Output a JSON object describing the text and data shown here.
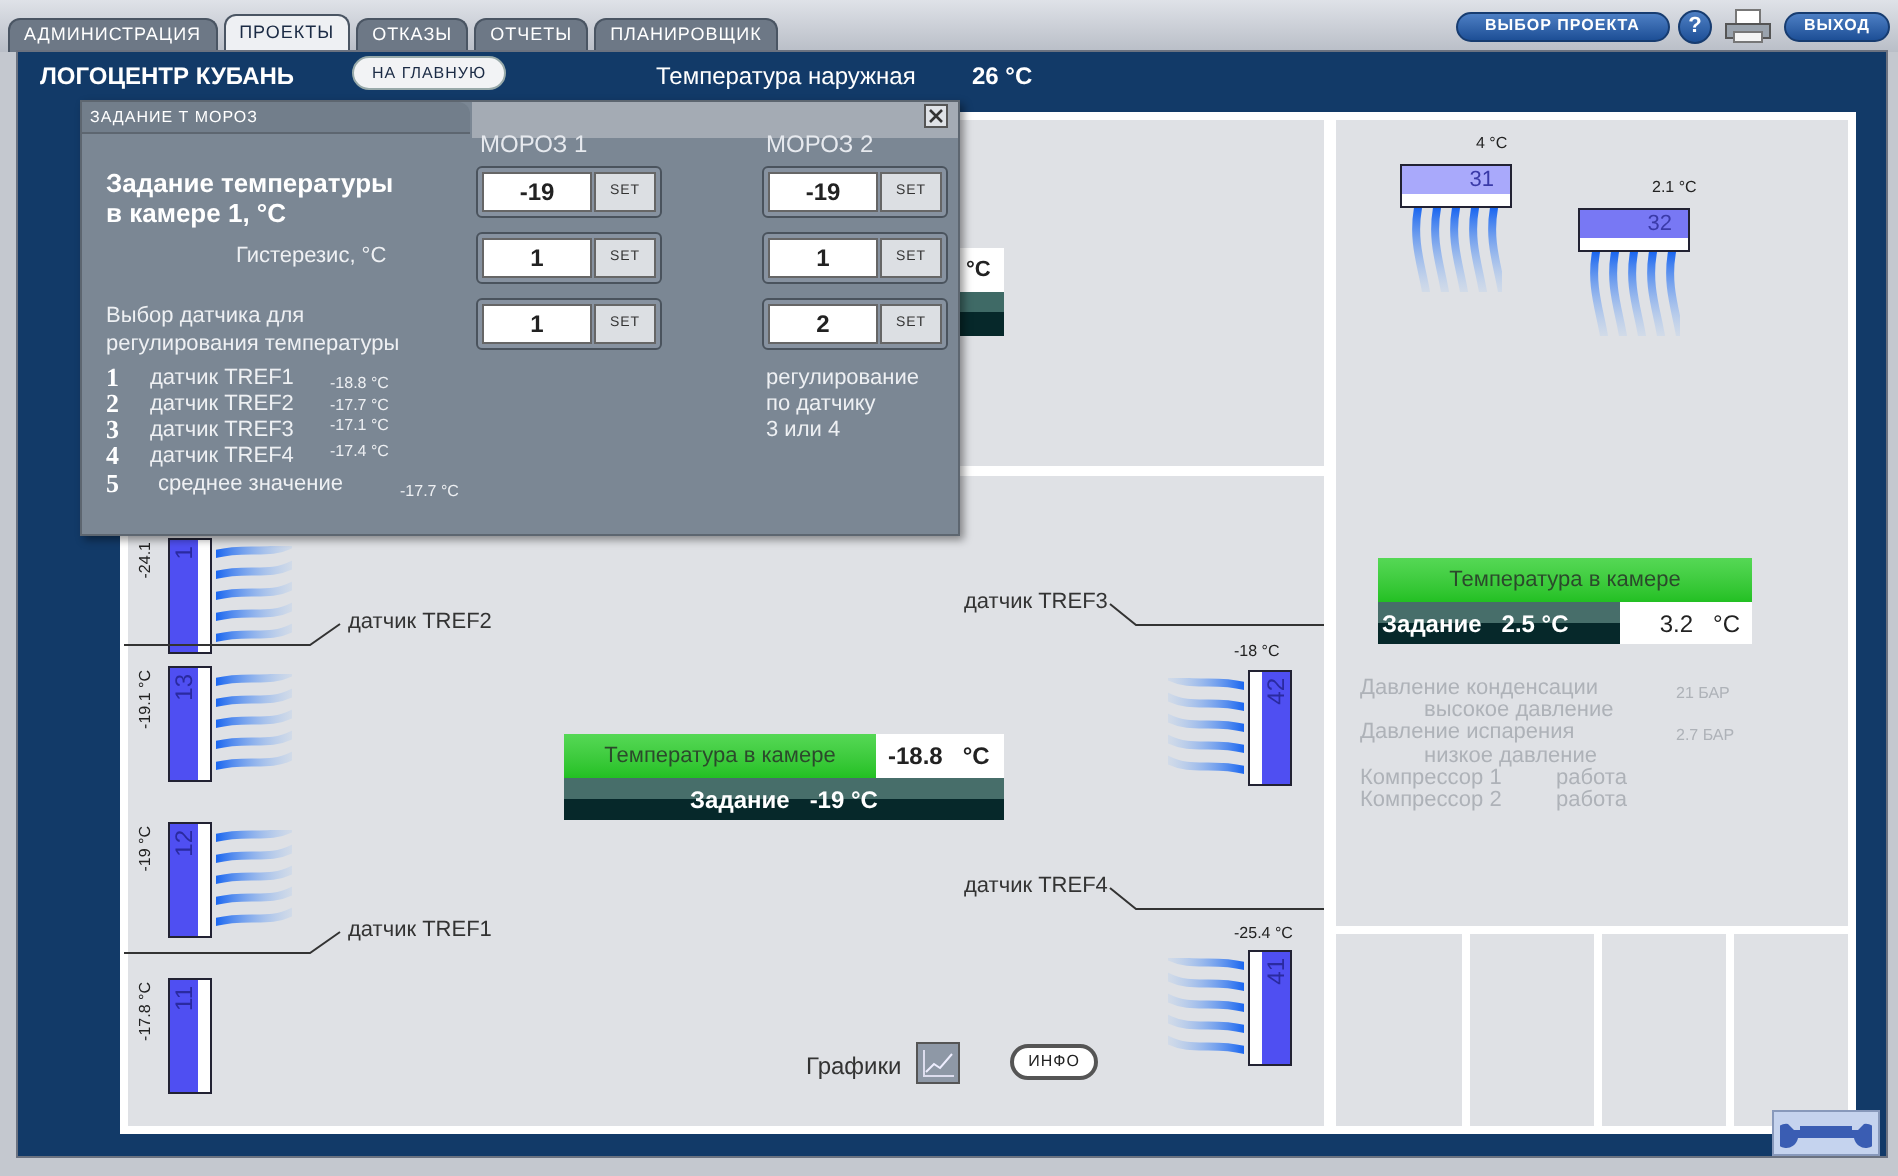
{
  "tabs": [
    {
      "label": "АДМИНИСТРАЦИЯ",
      "selected": false
    },
    {
      "label": "ПРОЕКТЫ",
      "selected": true
    },
    {
      "label": "ОТКАЗЫ",
      "selected": false
    },
    {
      "label": "ОТЧЕТЫ",
      "selected": false
    },
    {
      "label": "ПЛАНИРОВЩИК",
      "selected": false
    }
  ],
  "top_buttons": {
    "select_project": "ВЫБОР ПРОЕКТА",
    "help": "?",
    "exit": "ВЫХОД"
  },
  "header": {
    "site": "ЛОГОЦЕНТР КУБАНЬ",
    "home_button": "НА ГЛАВНУЮ",
    "outdoor_label": "Температура наружная",
    "outdoor_value": "26 °C"
  },
  "upper_room": {
    "panel_unit": "°C"
  },
  "lower_room": {
    "left_units": [
      {
        "number": "1",
        "temperature": "-24.1",
        "airflow": true
      },
      {
        "number": "13",
        "temperature": "-19.1 °C",
        "airflow": true
      },
      {
        "number": "12",
        "temperature": "-19 °C",
        "airflow": true
      },
      {
        "number": "11",
        "temperature": "-17.8 °C",
        "airflow": false
      }
    ],
    "right_units": [
      {
        "number": "42",
        "temperature": "-18 °C",
        "airflow": true
      },
      {
        "number": "41",
        "temperature": "-25.4 °C",
        "airflow": true
      }
    ],
    "sensors": [
      "датчик TREF2",
      "датчик TREF1",
      "датчик TREF3",
      "датчик TREF4"
    ],
    "panel": {
      "label": "Температура в камере",
      "value": "-18.8",
      "unit": "°C",
      "setpoint": "Задание   -19 °C"
    },
    "charts_label": "Графики",
    "info_button": "ИНФО"
  },
  "right_room": {
    "units": [
      {
        "number": "31",
        "temperature": "4 °C",
        "airflow": true
      },
      {
        "number": "32",
        "temperature": "2.1 °C",
        "airflow": true
      }
    ],
    "panel": {
      "label": "Температура в камере",
      "setpoint": "Задание   2.5 °C",
      "value": "3.2",
      "unit": "°C"
    },
    "readings": [
      {
        "label": "Давление конденсации",
        "value": "21 БАР"
      },
      {
        "label": "высокое давление"
      },
      {
        "label": "Давление испарения",
        "value": "2.7 БАР"
      },
      {
        "label": "низкое давление"
      },
      {
        "label": "Компрессор 1",
        "value": "работа"
      },
      {
        "label": "Компрессор 2",
        "value": "работа"
      }
    ]
  },
  "dialog": {
    "title": "ЗАДАНИЕ Т МОРОЗ",
    "columns": [
      "МОРОЗ 1",
      "МОРОЗ 2"
    ],
    "setpoint_label": [
      "Задание температуры",
      "в камере 1, °C"
    ],
    "hysteresis_label": "Гистерезис, °C",
    "sensor_label": [
      "Выбор датчика для",
      "регулирования температуры"
    ],
    "fields": [
      [
        {
          "value": "-19",
          "button": "SET"
        },
        {
          "value": "-19",
          "button": "SET"
        }
      ],
      [
        {
          "value": "1",
          "button": "SET"
        },
        {
          "value": "1",
          "button": "SET"
        }
      ],
      [
        {
          "value": "1",
          "button": "SET"
        },
        {
          "value": "2",
          "button": "SET"
        }
      ]
    ],
    "sensors": [
      {
        "number": "1",
        "name": "датчик TREF1",
        "value": "-18.8 °C"
      },
      {
        "number": "2",
        "name": "датчик TREF2",
        "value": "-17.7 °C"
      },
      {
        "number": "3",
        "name": "датчик TREF3",
        "value": "-17.1 °C"
      },
      {
        "number": "4",
        "name": "датчик TREF4",
        "value": "-17.4 °C"
      },
      {
        "number": "5",
        "name": "среднее значение",
        "value": "-17.7 °C"
      }
    ],
    "note": [
      "регулирование",
      "по датчику",
      "3 или 4"
    ]
  }
}
